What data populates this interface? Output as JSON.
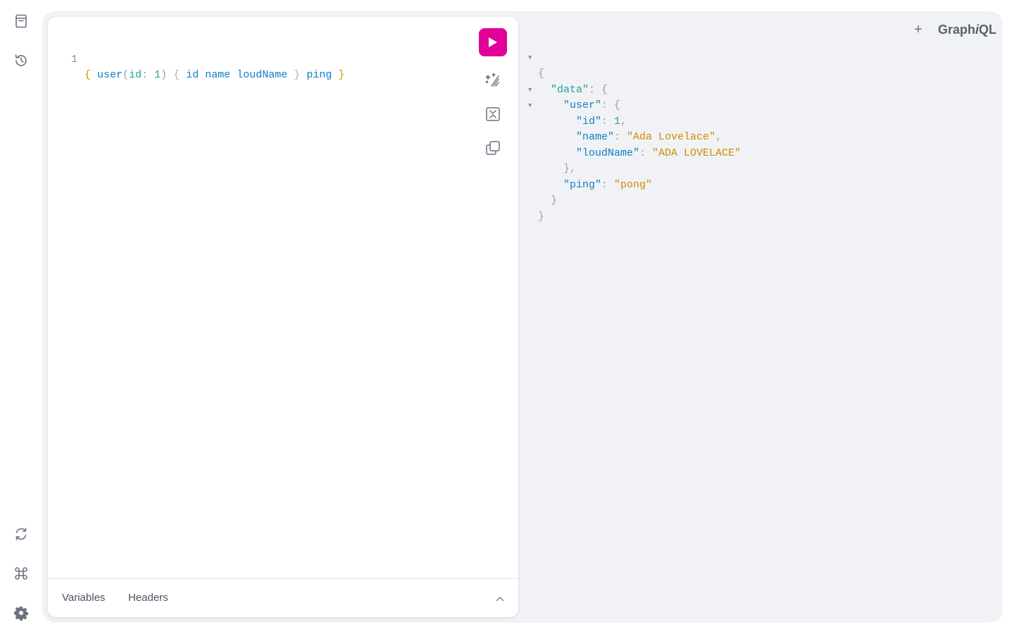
{
  "sidebar": {
    "top_icons": [
      "documentation-icon",
      "history-icon"
    ],
    "bottom_icons": [
      "refetch-schema-icon",
      "shortcuts-icon",
      "settings-icon"
    ]
  },
  "editor": {
    "line_number": "1",
    "query_tokens": {
      "open": "{",
      "field_user": "user",
      "paren_open": "(",
      "arg_id": "id",
      "colon": ":",
      "arg_value": "1",
      "paren_close": ")",
      "sel_open": "{",
      "field_id": "id",
      "field_name": "name",
      "field_loudName": "loudName",
      "sel_close": "}",
      "field_ping": "ping",
      "close": "}"
    },
    "toolbar": {
      "run_icon": "play-icon",
      "prettify_icon": "prettify-icon",
      "merge_icon": "merge-fragments-icon",
      "copy_icon": "copy-icon"
    },
    "footer": {
      "variables_label": "Variables",
      "headers_label": "Headers"
    }
  },
  "header": {
    "add_tab_label": "+",
    "logo_prefix": "Graph",
    "logo_italic": "i",
    "logo_suffix": "QL"
  },
  "result": {
    "data_key": "\"data\"",
    "user_key": "\"user\"",
    "id_key": "\"id\"",
    "id_value": "1",
    "name_key": "\"name\"",
    "name_value": "\"Ada Lovelace\"",
    "loudName_key": "\"loudName\"",
    "loudName_value": "\"ADA LOVELACE\"",
    "ping_key": "\"ping\"",
    "ping_value": "\"pong\""
  },
  "colors": {
    "accent": "#e10098",
    "background": "#f1f2f5"
  }
}
